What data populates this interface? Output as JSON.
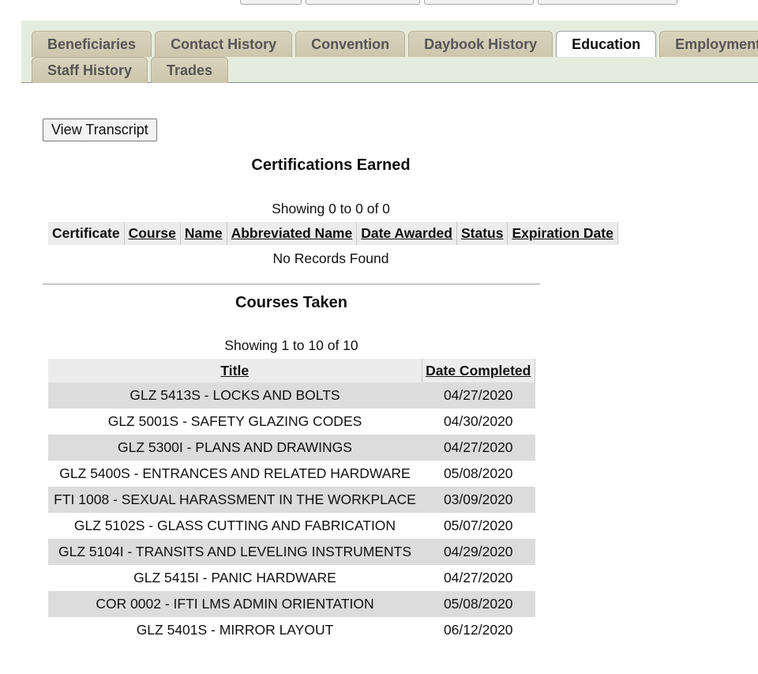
{
  "tabs": {
    "row1": [
      "Beneficiaries",
      "Contact History",
      "Convention",
      "Daybook History",
      "Education",
      "Employment"
    ],
    "row2": [
      "Staff History",
      "Trades"
    ],
    "active": "Education"
  },
  "actions": {
    "view_transcript": "View Transcript"
  },
  "certifications": {
    "title": "Certifications Earned",
    "showing": "Showing 0 to 0 of 0",
    "columns": [
      "Certificate",
      "Course",
      "Name",
      "Abbreviated Name",
      "Date Awarded",
      "Status",
      "Expiration Date"
    ],
    "empty_message": "No Records Found"
  },
  "courses": {
    "title": "Courses Taken",
    "showing": "Showing 1 to 10 of 10",
    "columns": [
      "Title",
      "Date Completed"
    ],
    "rows": [
      {
        "title": "GLZ 5413S - LOCKS AND BOLTS",
        "date": "04/27/2020"
      },
      {
        "title": "GLZ 5001S - SAFETY GLAZING CODES",
        "date": "04/30/2020"
      },
      {
        "title": "GLZ 5300I - PLANS AND DRAWINGS",
        "date": "04/27/2020"
      },
      {
        "title": "GLZ 5400S - ENTRANCES AND RELATED HARDWARE",
        "date": "05/08/2020"
      },
      {
        "title": "FTI 1008 - SEXUAL HARASSMENT IN THE WORKPLACE",
        "date": "03/09/2020"
      },
      {
        "title": "GLZ 5102S - GLASS CUTTING AND FABRICATION",
        "date": "05/07/2020"
      },
      {
        "title": "GLZ 5104I - TRANSITS AND LEVELING INSTRUMENTS",
        "date": "04/29/2020"
      },
      {
        "title": "GLZ 5415I - PANIC HARDWARE",
        "date": "04/27/2020"
      },
      {
        "title": "COR 0002 - IFTI LMS ADMIN ORIENTATION",
        "date": "05/08/2020"
      },
      {
        "title": "GLZ 5401S - MIRROR LAYOUT",
        "date": "06/12/2020"
      }
    ]
  }
}
